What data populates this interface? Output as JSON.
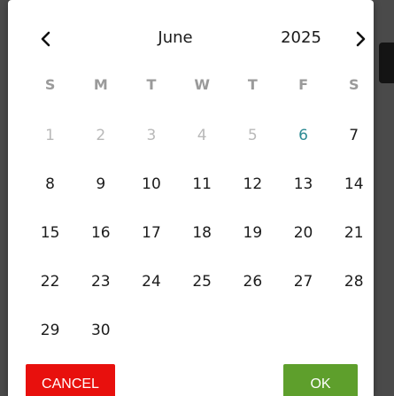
{
  "header": {
    "month": "June",
    "year": "2025",
    "prev_icon": "chevron-left-icon",
    "next_icon": "chevron-right-icon"
  },
  "weekdays": [
    "S",
    "M",
    "T",
    "W",
    "T",
    "F",
    "S"
  ],
  "days": [
    {
      "label": "1",
      "state": "disabled"
    },
    {
      "label": "2",
      "state": "disabled"
    },
    {
      "label": "3",
      "state": "disabled"
    },
    {
      "label": "4",
      "state": "disabled"
    },
    {
      "label": "5",
      "state": "disabled"
    },
    {
      "label": "6",
      "state": "today"
    },
    {
      "label": "7",
      "state": "normal"
    },
    {
      "label": "8",
      "state": "normal"
    },
    {
      "label": "9",
      "state": "normal"
    },
    {
      "label": "10",
      "state": "normal"
    },
    {
      "label": "11",
      "state": "normal"
    },
    {
      "label": "12",
      "state": "normal"
    },
    {
      "label": "13",
      "state": "normal"
    },
    {
      "label": "14",
      "state": "normal"
    },
    {
      "label": "15",
      "state": "normal"
    },
    {
      "label": "16",
      "state": "normal"
    },
    {
      "label": "17",
      "state": "normal"
    },
    {
      "label": "18",
      "state": "normal"
    },
    {
      "label": "19",
      "state": "normal"
    },
    {
      "label": "20",
      "state": "normal"
    },
    {
      "label": "21",
      "state": "normal"
    },
    {
      "label": "22",
      "state": "normal"
    },
    {
      "label": "23",
      "state": "normal"
    },
    {
      "label": "24",
      "state": "normal"
    },
    {
      "label": "25",
      "state": "normal"
    },
    {
      "label": "26",
      "state": "normal"
    },
    {
      "label": "27",
      "state": "normal"
    },
    {
      "label": "28",
      "state": "normal"
    },
    {
      "label": "29",
      "state": "normal"
    },
    {
      "label": "30",
      "state": "normal"
    }
  ],
  "actions": {
    "cancel_label": "CANCEL",
    "ok_label": "OK"
  },
  "colors": {
    "cancel": "#e8100d",
    "ok": "#5e9f2c",
    "today": "#2e8b94",
    "disabled": "#b9b9b9"
  }
}
